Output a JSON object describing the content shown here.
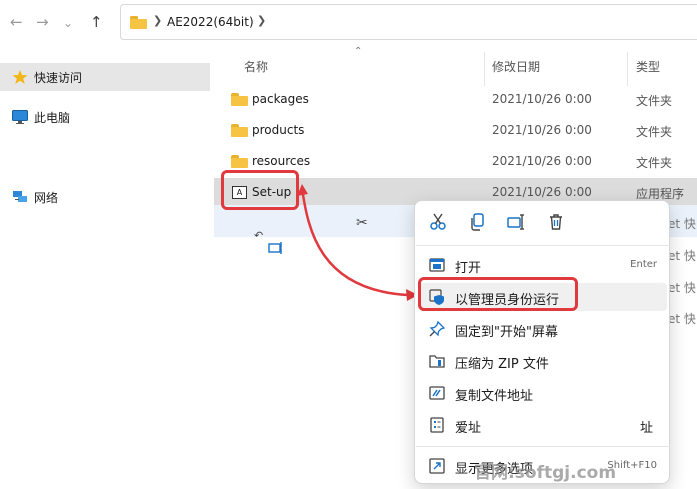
{
  "nav": {
    "back": "←",
    "forward": "→",
    "recent": "⌄",
    "up": "↑",
    "breadcrumb": "AE2022(64bit)"
  },
  "sidebar": {
    "items": [
      {
        "label": "快速访问",
        "icon": "star-icon"
      },
      {
        "label": "此电脑",
        "icon": "monitor-icon"
      },
      {
        "label": "网络",
        "icon": "network-icon"
      }
    ]
  },
  "columns": {
    "name": "名称",
    "date": "修改日期",
    "type": "类型"
  },
  "files": [
    {
      "name": "packages",
      "date": "2021/10/26 0:00",
      "type": "文件夹",
      "icon": "folder-icon"
    },
    {
      "name": "products",
      "date": "2021/10/26 0:00",
      "type": "文件夹",
      "icon": "folder-icon"
    },
    {
      "name": "resources",
      "date": "2021/10/26 0:00",
      "type": "文件夹",
      "icon": "folder-icon"
    },
    {
      "name": "Set-up",
      "date": "2021/10/26 0:00",
      "type": "应用程序",
      "icon": "adobe-app-icon"
    }
  ],
  "ghost_types": [
    "et 快",
    "et 快",
    "et 快",
    "et 快"
  ],
  "context_menu": {
    "quick_actions": [
      "cut-icon",
      "copy-icon",
      "rename-icon",
      "delete-icon"
    ],
    "items": [
      {
        "label": "打开",
        "shortcut": "Enter",
        "icon": "open-icon"
      },
      {
        "label": "以管理员身份运行",
        "shortcut": "",
        "icon": "shield-icon"
      },
      {
        "label": "固定到\"开始\"屏幕",
        "shortcut": "",
        "icon": "pin-icon"
      },
      {
        "label": "压缩为 ZIP 文件",
        "shortcut": "",
        "icon": "zip-icon"
      },
      {
        "label": "复制文件地址",
        "shortcut": "",
        "icon": "copy-path-icon"
      },
      {
        "label": "爱址",
        "shortcut": "址",
        "icon": "properties-icon"
      },
      {
        "label": "显示更多选项",
        "shortcut": "Shift+F10",
        "icon": "more-options-icon"
      }
    ]
  },
  "watermark": "官网:softgj.com",
  "colors": {
    "highlight": "#e0393e",
    "selection": "#dcdcdc",
    "folder": "#f6c343",
    "accent": "#1a73c9"
  }
}
